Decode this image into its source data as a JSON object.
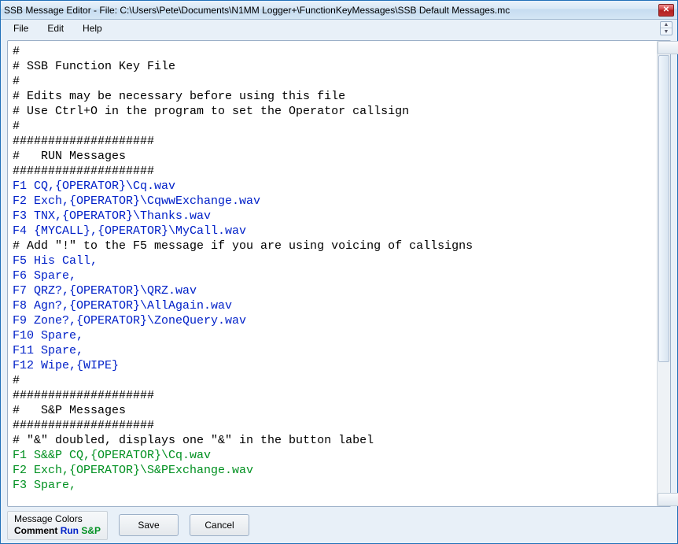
{
  "title": "SSB Message Editor - File: C:\\Users\\Pete\\Documents\\N1MM Logger+\\FunctionKeyMessages\\SSB Default Messages.mc",
  "menu": {
    "file": "File",
    "edit": "Edit",
    "help": "Help"
  },
  "lines": [
    {
      "cls": "",
      "text": "#"
    },
    {
      "cls": "",
      "text": "# SSB Function Key File"
    },
    {
      "cls": "",
      "text": "#"
    },
    {
      "cls": "",
      "text": "# Edits may be necessary before using this file"
    },
    {
      "cls": "",
      "text": "# Use Ctrl+O in the program to set the Operator callsign"
    },
    {
      "cls": "",
      "text": "#"
    },
    {
      "cls": "",
      "text": "####################"
    },
    {
      "cls": "",
      "text": "#   RUN Messages"
    },
    {
      "cls": "",
      "text": "####################"
    },
    {
      "cls": "blue",
      "text": "F1 CQ,{OPERATOR}\\Cq.wav"
    },
    {
      "cls": "blue",
      "text": "F2 Exch,{OPERATOR}\\CqwwExchange.wav"
    },
    {
      "cls": "blue",
      "text": "F3 TNX,{OPERATOR}\\Thanks.wav"
    },
    {
      "cls": "blue",
      "text": "F4 {MYCALL},{OPERATOR}\\MyCall.wav"
    },
    {
      "cls": "",
      "text": "# Add \"!\" to the F5 message if you are using voicing of callsigns"
    },
    {
      "cls": "blue",
      "text": "F5 His Call,"
    },
    {
      "cls": "blue",
      "text": "F6 Spare,"
    },
    {
      "cls": "blue",
      "text": "F7 QRZ?,{OPERATOR}\\QRZ.wav"
    },
    {
      "cls": "blue",
      "text": "F8 Agn?,{OPERATOR}\\AllAgain.wav"
    },
    {
      "cls": "blue",
      "text": "F9 Zone?,{OPERATOR}\\ZoneQuery.wav"
    },
    {
      "cls": "blue",
      "text": "F10 Spare,"
    },
    {
      "cls": "blue",
      "text": "F11 Spare,"
    },
    {
      "cls": "blue",
      "text": "F12 Wipe,{WIPE}"
    },
    {
      "cls": "",
      "text": "#"
    },
    {
      "cls": "",
      "text": "####################"
    },
    {
      "cls": "",
      "text": "#   S&P Messages"
    },
    {
      "cls": "",
      "text": "####################"
    },
    {
      "cls": "",
      "text": "# \"&\" doubled, displays one \"&\" in the button label"
    },
    {
      "cls": "green",
      "text": "F1 S&&P CQ,{OPERATOR}\\Cq.wav"
    },
    {
      "cls": "green",
      "text": "F2 Exch,{OPERATOR}\\S&PExchange.wav"
    },
    {
      "cls": "green",
      "text": "F3 Spare,"
    }
  ],
  "legend": {
    "title": "Message Colors",
    "comment": "Comment",
    "run": "Run",
    "sp": "S&P"
  },
  "buttons": {
    "save": "Save",
    "cancel": "Cancel"
  }
}
